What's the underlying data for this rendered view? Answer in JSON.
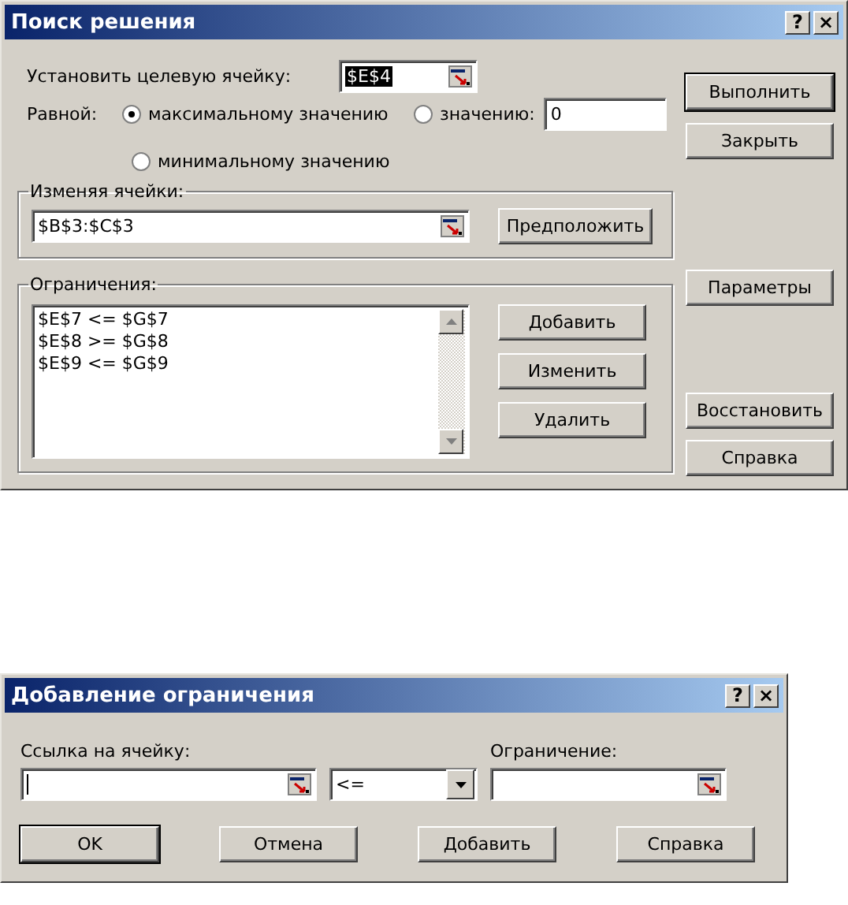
{
  "solver_dialog": {
    "title": "Поиск решения",
    "title_buttons": [
      "?",
      "×"
    ],
    "target_cell": {
      "label": "Установить целевую ячейку:",
      "value": "$E$4",
      "selected": true
    },
    "equal_to": {
      "label": "Равной:",
      "options": [
        {
          "label": "максимальному значению",
          "selected": true
        },
        {
          "label": "значению:",
          "selected": false
        },
        {
          "label": "минимальному значению",
          "selected": false
        }
      ],
      "value": "0"
    },
    "changing_cells": {
      "label": "Изменяя ячейки:",
      "value": "$B$3:$C$3",
      "button": "Предположить"
    },
    "constraints": {
      "label": "Ограничения:",
      "items": [
        "$E$7 <= $G$7",
        "$E$8 >= $G$8",
        "$E$9 <= $G$9"
      ],
      "buttons": [
        "Добавить",
        "Изменить",
        "Удалить"
      ]
    },
    "buttons": [
      {
        "label": "Выполнить",
        "default": true
      },
      {
        "label": "Закрыть",
        "default": false
      },
      {
        "label": "Параметры",
        "default": false
      },
      {
        "label": "Восстановить",
        "default": false
      },
      {
        "label": "Справка",
        "default": false
      }
    ]
  },
  "constraint_dialog": {
    "title": "Добавление ограничения",
    "title_buttons": [
      "?",
      "×"
    ],
    "cell_ref": {
      "label": "Ссылка на ячейку:",
      "focused": true
    },
    "operator": "<=",
    "constraint": {
      "label": "Ограничение:"
    },
    "buttons": [
      {
        "label": "OK",
        "default": true
      },
      {
        "label": "Отмена",
        "default": false
      },
      {
        "label": "Добавить",
        "default": false
      },
      {
        "label": "Справка",
        "default": false
      }
    ]
  }
}
